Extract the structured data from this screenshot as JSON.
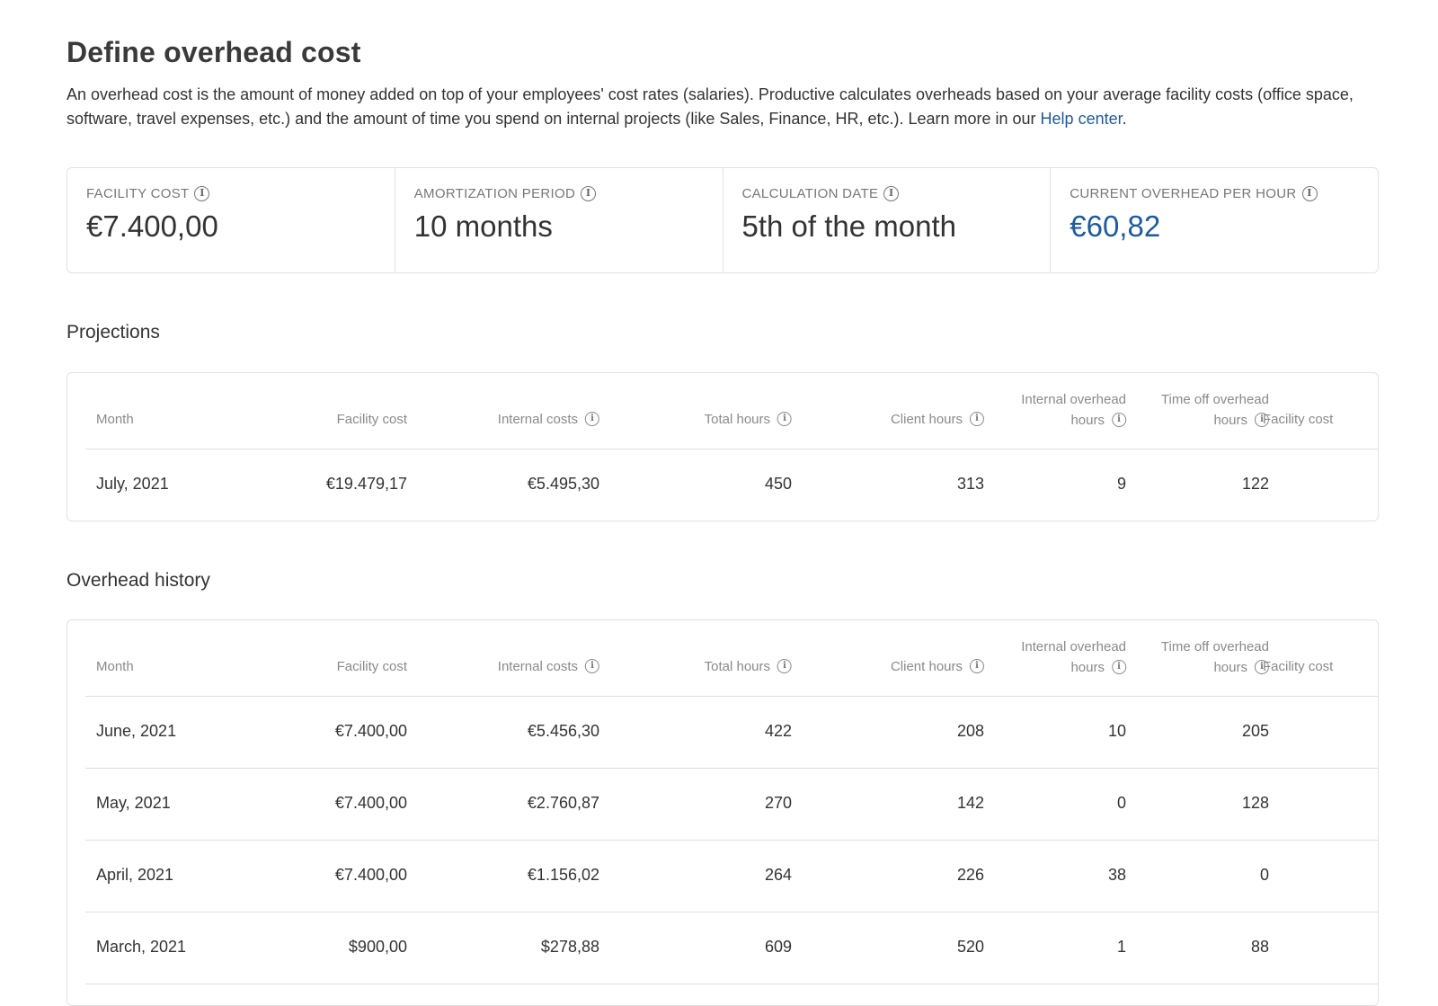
{
  "header": {
    "title": "Define overhead cost",
    "description": "An overhead cost is the amount of money added on top of your employees' cost rates (salaries). Productive calculates overheads based on your average facility costs (office space, software, travel expenses, etc.) and the amount of time you spend on internal projects (like Sales, Finance, HR, etc.). Learn more in our ",
    "help_link": "Help center",
    "desc_end": "."
  },
  "cards": [
    {
      "label": "Facility cost",
      "value": "€7.400,00"
    },
    {
      "label": "Amortization period",
      "value": "10 months"
    },
    {
      "label": "Calculation date",
      "value": "5th of the month"
    },
    {
      "label": "Current overhead per hour",
      "value": "€60,82"
    }
  ],
  "columns": {
    "month": "Month",
    "facility_cost": "Facility cost",
    "internal_costs": "Internal costs",
    "total_hours": "Total hours",
    "client_hours": "Client hours",
    "internal_overhead_1": "Internal overhead",
    "internal_overhead_2": "hours",
    "time_off_1": "Time off overhead",
    "time_off_2": "hours",
    "facility_cost_2": "Facility cost"
  },
  "projections": {
    "title": "Projections",
    "rows": [
      {
        "month": "July, 2021",
        "facility": "€19.479,17",
        "internal": "€5.495,30",
        "total": "450",
        "client": "313",
        "internal_oh": "9",
        "time_off": "122"
      }
    ]
  },
  "history": {
    "title": "Overhead history",
    "rows": [
      {
        "month": "June, 2021",
        "facility": "€7.400,00",
        "internal": "€5.456,30",
        "total": "422",
        "client": "208",
        "internal_oh": "10",
        "time_off": "205"
      },
      {
        "month": "May, 2021",
        "facility": "€7.400,00",
        "internal": "€2.760,87",
        "total": "270",
        "client": "142",
        "internal_oh": "0",
        "time_off": "128"
      },
      {
        "month": "April, 2021",
        "facility": "€7.400,00",
        "internal": "€1.156,02",
        "total": "264",
        "client": "226",
        "internal_oh": "38",
        "time_off": "0"
      },
      {
        "month": "March, 2021",
        "facility": "$900,00",
        "internal": "$278,88",
        "total": "609",
        "client": "520",
        "internal_oh": "1",
        "time_off": "88"
      }
    ]
  }
}
